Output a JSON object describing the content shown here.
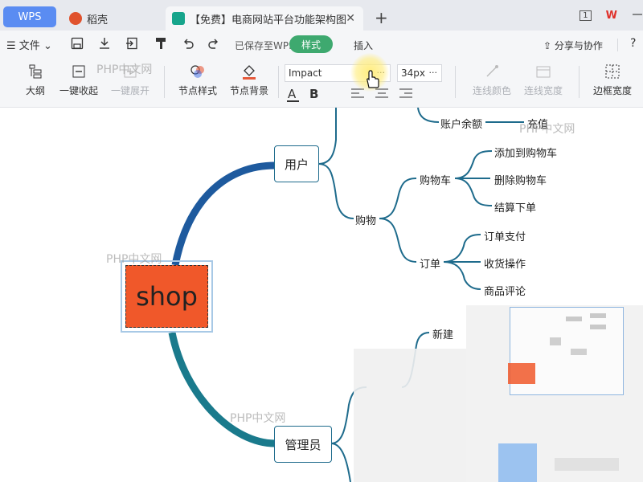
{
  "tabs": {
    "wps": "WPS",
    "daoke": "稻壳",
    "doc": "【免费】电商网站平台功能架构图",
    "close": "✕",
    "new": "+"
  },
  "window": {
    "tab_count": "1",
    "brand": "W"
  },
  "menu": {
    "file": "文件",
    "saved": "已保存至WPS",
    "style_tab": "样式",
    "insert_tab": "插入",
    "share": "分享与协作",
    "help": "?"
  },
  "ribbon": {
    "outline": "大纲",
    "collapse_all": "一键收起",
    "expand_all": "一键展开",
    "node_style": "节点样式",
    "node_bg": "节点背景",
    "font_value": "Impact",
    "font_more": "···",
    "size_value": "34px",
    "size_more": "···",
    "line_color": "连线颜色",
    "line_width": "连线宽度",
    "border_width": "边框宽度"
  },
  "watermark": "PHP中文网",
  "mindmap": {
    "root": "shop",
    "user": "用户",
    "admin": "管理员",
    "account_balance": "账户余额",
    "recharge": "充值",
    "shopping": "购物",
    "cart": "购物车",
    "add_to_cart": "添加到购物车",
    "remove_from_cart": "删除购物车",
    "checkout": "结算下单",
    "order": "订单",
    "order_pay": "订单支付",
    "receive_op": "收货操作",
    "product_review": "商品评论",
    "new": "新建"
  },
  "colors": {
    "accent_green": "#3ea96f",
    "root_fill": "#f0582a",
    "branch_dark": "#1e6b8c",
    "tab_blue": "#5a8cf2"
  }
}
